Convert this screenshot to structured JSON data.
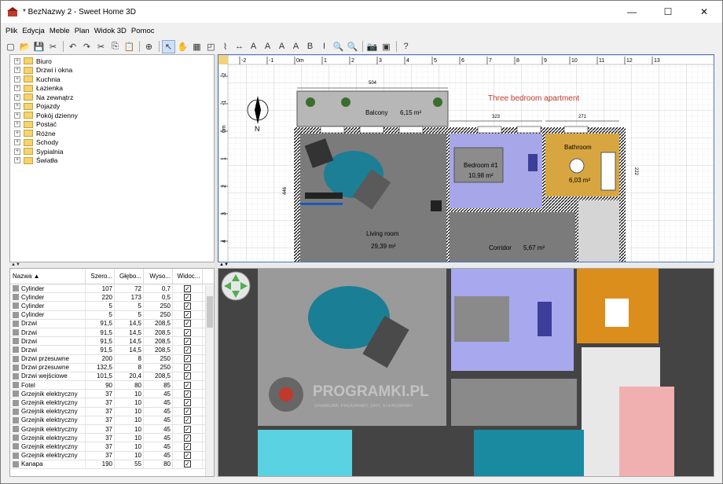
{
  "window": {
    "title": "* BezNazwy 2 - Sweet Home 3D",
    "min": "—",
    "max": "☐",
    "close": "✕"
  },
  "menu": [
    "Plik",
    "Edycja",
    "Meble",
    "Plan",
    "Widok 3D",
    "Pomoc"
  ],
  "toolbar": [
    "new-icon",
    "open-icon",
    "save-icon",
    "cut-tool-icon",
    "sep",
    "undo-icon",
    "redo-icon",
    "cut-icon",
    "copy-icon",
    "paste-icon",
    "sep",
    "add-furniture-icon",
    "sep",
    "select-icon",
    "pan-icon",
    "create-walls-icon",
    "create-rooms-icon",
    "create-polylines-icon",
    "create-dimensions-icon",
    "create-labels-icon",
    "text-style-icon",
    "increase-text-icon",
    "decrease-text-icon",
    "bold-icon",
    "italic-icon",
    "zoom-in-icon",
    "zoom-out-icon",
    "sep",
    "photo-icon",
    "video-icon",
    "sep",
    "help-icon"
  ],
  "catalog": [
    "Biuro",
    "Drzwi i okna",
    "Kuchnia",
    "Łazienka",
    "Na zewnątrz",
    "Pojazdy",
    "Pokój dzienny",
    "Postać",
    "Różne",
    "Schody",
    "Sypialnia",
    "Światła"
  ],
  "furniture_headers": [
    "Nazwa ▲",
    "Szero...",
    "Głębo...",
    "Wyso...",
    "Widoc..."
  ],
  "furniture_rows": [
    [
      "Cylinder",
      "107",
      "72",
      "0,7",
      "✓"
    ],
    [
      "Cylinder",
      "220",
      "173",
      "0,5",
      "✓"
    ],
    [
      "Cylinder",
      "5",
      "5",
      "250",
      "✓"
    ],
    [
      "Cylinder",
      "5",
      "5",
      "250",
      "✓"
    ],
    [
      "Drzwi",
      "91,5",
      "14,5",
      "208,5",
      "✓"
    ],
    [
      "Drzwi",
      "91,5",
      "14,5",
      "208,5",
      "✓"
    ],
    [
      "Drzwi",
      "91,5",
      "14,5",
      "208,5",
      "✓"
    ],
    [
      "Drzwi",
      "91,5",
      "14,5",
      "208,5",
      "✓"
    ],
    [
      "Drzwi przesuwne",
      "200",
      "8",
      "250",
      "✓"
    ],
    [
      "Drzwi przesuwne",
      "132,5",
      "8",
      "250",
      "✓"
    ],
    [
      "Drzwi wejściowe",
      "101,5",
      "20,4",
      "208,5",
      "✓"
    ],
    [
      "Fotel",
      "90",
      "80",
      "85",
      "✓"
    ],
    [
      "Grzejnik elektryczny",
      "37",
      "10",
      "45",
      "✓"
    ],
    [
      "Grzejnik elektryczny",
      "37",
      "10",
      "45",
      "✓"
    ],
    [
      "Grzejnik elektryczny",
      "37",
      "10",
      "45",
      "✓"
    ],
    [
      "Grzejnik elektryczny",
      "37",
      "10",
      "45",
      "✓"
    ],
    [
      "Grzejnik elektryczny",
      "37",
      "10",
      "45",
      "✓"
    ],
    [
      "Grzejnik elektryczny",
      "37",
      "10",
      "45",
      "✓"
    ],
    [
      "Grzejnik elektryczny",
      "37",
      "10",
      "45",
      "✓"
    ],
    [
      "Grzejnik elektryczny",
      "37",
      "10",
      "45",
      "✓"
    ],
    [
      "Kanapa",
      "190",
      "55",
      "80",
      "✓"
    ]
  ],
  "plan": {
    "ruler_x": [
      "-2",
      "-1",
      "0m",
      "1",
      "2",
      "3",
      "4",
      "5",
      "6",
      "7",
      "8",
      "9",
      "10",
      "11",
      "12",
      "13"
    ],
    "ruler_y": [
      "-2",
      "-1",
      "0m",
      "1",
      "2",
      "3",
      "4"
    ],
    "title_label": "Three bedroom apartment",
    "rooms": [
      {
        "name": "Balcony",
        "area": "6,15 m²"
      },
      {
        "name": "Bedroom #1",
        "area": "10,98 m²"
      },
      {
        "name": "Bathroom",
        "area": "6,03 m²"
      },
      {
        "name": "Living room",
        "area": "29,39 m²"
      },
      {
        "name": "Corridor",
        "area": "5,67 m²"
      }
    ],
    "dimensions": [
      "504",
      "323",
      "271",
      "222",
      "446"
    ],
    "compass": "N"
  },
  "view3d": {
    "watermark": "PROGRAMKI.PL",
    "watermark_sub": "DARMOWE PROGRAMY, GRY, STEROWNIKI",
    "nav_arrows": "◆"
  },
  "colors": {
    "accent": "#4a77c0",
    "bedroom": "#a6a6e8",
    "bathroom": "#d8a640",
    "living": "#7a7a7a",
    "pool": "#1a8aa0"
  }
}
